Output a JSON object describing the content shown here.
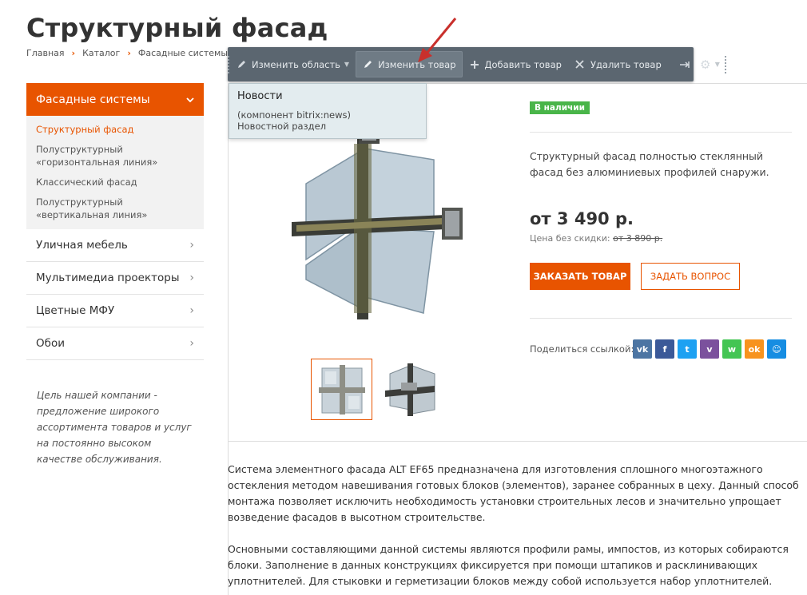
{
  "page": {
    "title": "Структурный фасад"
  },
  "breadcrumb": {
    "items": [
      "Главная",
      "Каталог",
      "Фасадные системы"
    ],
    "separator": "›"
  },
  "toolbar": {
    "edit_area": "Изменить область",
    "edit_product": "Изменить товар",
    "add_product": "Добавить товар",
    "delete_product": "Удалить товар"
  },
  "tooltip": {
    "title": "Новости",
    "component": "(компонент bitrix:news)",
    "section": "Новостной раздел"
  },
  "sidebar": {
    "active": "Фасадные системы",
    "subitems": [
      "Структурный фасад",
      "Полуструктурный «горизонтальная линия»",
      "Классический фасад",
      "Полуструктурный «вертикальная линия»"
    ],
    "items": [
      "Уличная мебель",
      "Мультимедиа проекторы",
      "Цветные МФУ",
      "Обои"
    ],
    "note": "Цель нашей компании - предложение широкого ассортимента товаров и услуг на постоянно высоком качестве обслуживания."
  },
  "product": {
    "badge": "В наличии",
    "description": "Структурный фасад  полностью стеклянный фасад без алюминиевых профилей снаружи.",
    "price": "от 3 490 р.",
    "old_price_label": "Цена без скидки:",
    "old_price": "от 3 890 р.",
    "order_button": "ЗАКАЗАТЬ ТОВАР",
    "ask_button": "ЗАДАТЬ ВОПРОС",
    "share_label": "Поделиться ссылкой:"
  },
  "share_icons": [
    {
      "name": "vk",
      "glyph": "vk",
      "color": "#4c75a3"
    },
    {
      "name": "facebook",
      "glyph": "f",
      "color": "#3b5998"
    },
    {
      "name": "twitter",
      "glyph": "t",
      "color": "#1da1f2"
    },
    {
      "name": "viber",
      "glyph": "v",
      "color": "#7b519d"
    },
    {
      "name": "whatsapp",
      "glyph": "w",
      "color": "#43c553"
    },
    {
      "name": "odnoklassniki",
      "glyph": "ok",
      "color": "#f7931e"
    },
    {
      "name": "moimir",
      "glyph": "☺",
      "color": "#168de2"
    }
  ],
  "article": {
    "p1": "Система элементного фасада ALT EF65 предназначена для изготовления сплошного многоэтажного остекления методом навешивания готовых блоков (элементов), заранее собранных в цеху. Данный способ монтажа позволяет исключить необходимость установки строительных лесов и значительно упрощает возведение фасадов в высотном строительстве.",
    "p2": "Основными составляющими данной системы являются профили рамы, импостов, из которых собираются блоки. Заполнение в данных конструкциях фиксируется при помощи штапиков и расклинивающих уплотнителей. Для стыковки и герметизации блоков между собой используется набор уплотнителей."
  },
  "colors": {
    "accent": "#e85400",
    "badge": "#49b549",
    "toolbar": "#5b6670"
  }
}
